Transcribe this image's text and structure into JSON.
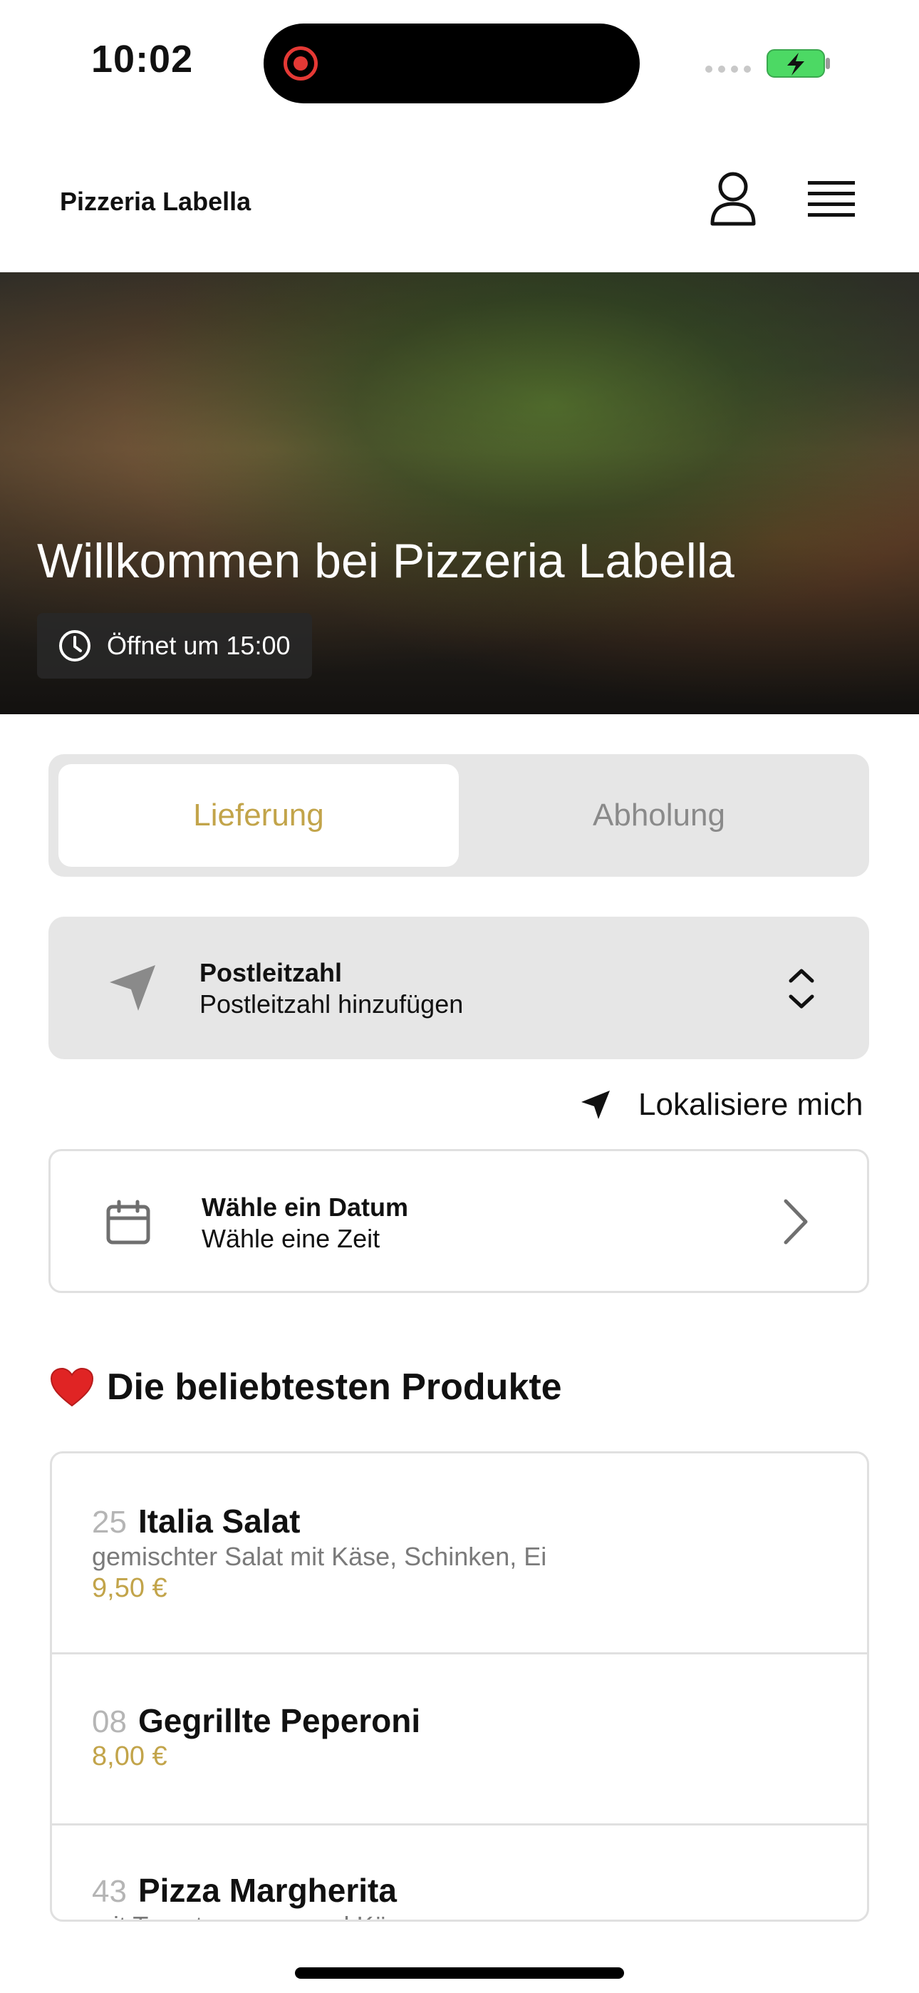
{
  "status_bar": {
    "time": "10:02"
  },
  "header": {
    "brand": "Pizzeria Labella"
  },
  "hero": {
    "title": "Willkommen bei Pizzeria Labella",
    "open_text": "Öffnet um 15:00"
  },
  "order_mode": {
    "options": [
      "Lieferung",
      "Abholung"
    ],
    "selected": "Lieferung"
  },
  "postal": {
    "title": "Postleitzahl",
    "placeholder": "Postleitzahl hinzufügen"
  },
  "locate": {
    "label": "Lokalisiere mich"
  },
  "date_picker": {
    "title": "Wähle ein Datum",
    "subtitle": "Wähle eine Zeit"
  },
  "popular": {
    "title": "Die beliebtesten Produkte",
    "items": [
      {
        "number": "25",
        "name": "Italia Salat",
        "description": "gemischter Salat mit Käse, Schinken, Ei",
        "price": "9,50 €"
      },
      {
        "number": "08",
        "name": "Gegrillte Peperoni",
        "price": "8,00 €"
      },
      {
        "number": "43",
        "name": "Pizza Margherita",
        "description": "mit Tomatensauce und Käse"
      }
    ]
  },
  "colors": {
    "accent": "#c2a44a",
    "muted": "#8a8a8a",
    "panel": "#e6e6e6"
  },
  "icons": [
    "record-icon",
    "signal-icon",
    "battery-charging-icon",
    "user-icon",
    "menu-icon",
    "clock-icon",
    "location-arrow-icon",
    "chevron-updown-icon",
    "calendar-icon",
    "chevron-right-icon",
    "heart-icon"
  ]
}
